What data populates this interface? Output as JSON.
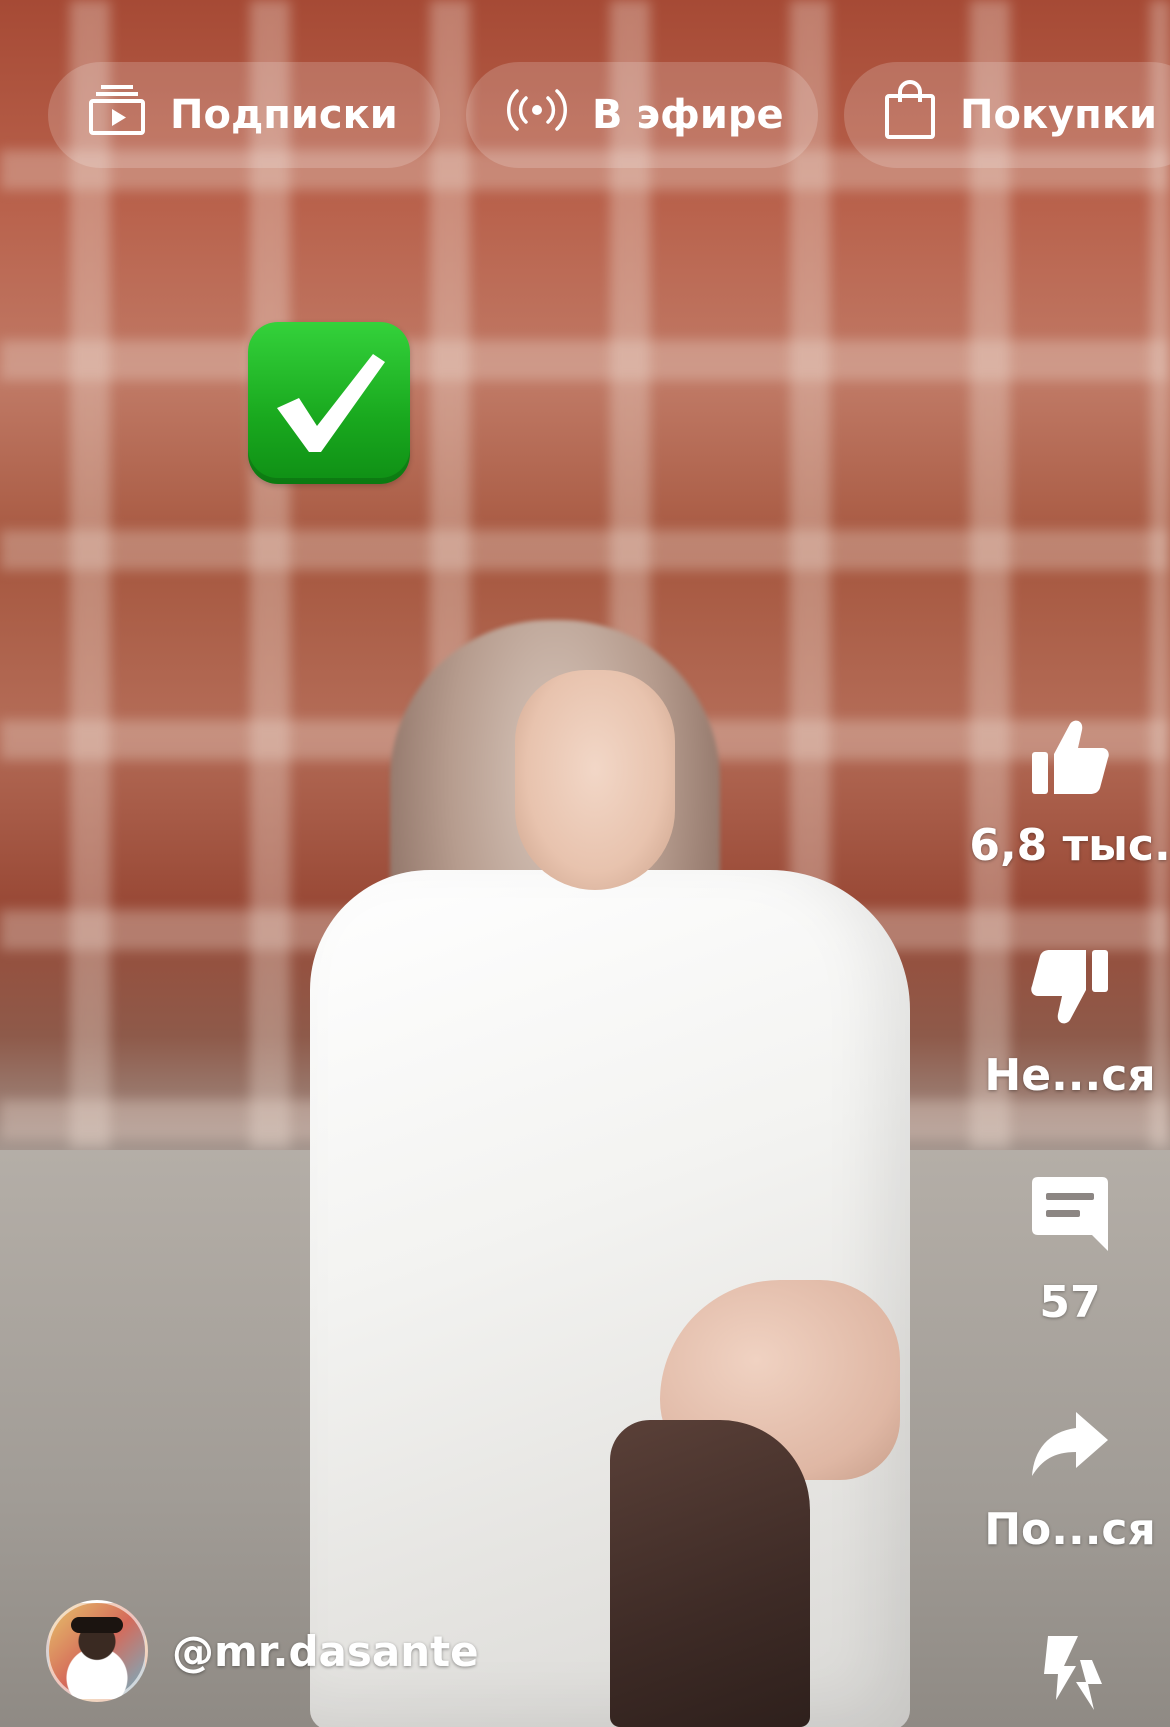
{
  "top_nav": {
    "subscriptions_label": "Подписки",
    "live_label": "В эфире",
    "shopping_label": "Покупки"
  },
  "sticker": {
    "icon": "check-mark-button-emoji",
    "color": "#1fb526"
  },
  "actions": {
    "like_count": "6,8 тыс.",
    "dislike_label": "Не...ся",
    "comments_count": "57",
    "share_label": "По...ся"
  },
  "author": {
    "handle": "@mr.dasante"
  }
}
